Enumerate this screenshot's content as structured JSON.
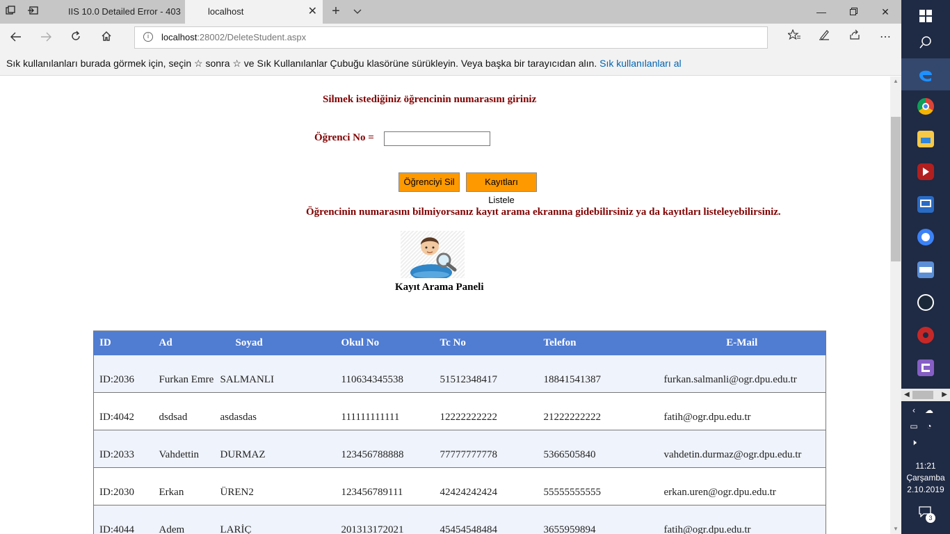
{
  "browser": {
    "tabs": [
      {
        "label": "IIS 10.0 Detailed Error - 403",
        "active": false
      },
      {
        "label": "localhost",
        "active": true
      }
    ],
    "new_tab_icon": "+",
    "tab_list_icon": "⌄",
    "address": {
      "host": "localhost",
      "path": ":28002/DeleteStudent.aspx"
    },
    "favorites_bar": {
      "text": "Sık kullanılanları burada görmek için, seçin  ☆  sonra ☆ ve Sık Kullanılanlar Çubuğu klasörüne sürükleyin. Veya başka bir tarayıcıdan alın.",
      "link": "Sık kullanılanları al"
    }
  },
  "page": {
    "heading": "Silmek istediğiniz öğrencinin numarasını giriniz",
    "student_no_label": "Öğrenci No =",
    "student_no_value": "",
    "delete_button": "Öğrenciyi Sil",
    "list_button": "Kayıtları Listele",
    "info_text": "Öğrencinin numarasını bilmiyorsanız kayıt arama ekranına gidebilirsiniz ya da kayıtları listeleyebilirsiniz.",
    "search_panel_label": "Kayıt Arama Paneli",
    "table": {
      "headers": [
        "ID",
        "Ad",
        "Soyad",
        "Okul No",
        "Tc No",
        "Telefon",
        "E-Mail"
      ],
      "rows": [
        [
          "ID:2036",
          "Furkan Emre",
          "SALMANLI",
          "110634345538",
          "51512348417",
          "18841541387",
          "furkan.salmanli@ogr.dpu.edu.tr"
        ],
        [
          "ID:4042",
          "dsdsad",
          "asdasdas",
          "111111111111",
          "12222222222",
          "21222222222",
          "fatih@ogr.dpu.edu.tr"
        ],
        [
          "ID:2033",
          "Vahdettin",
          "DURMAZ",
          "123456788888",
          "77777777778",
          "5366505840",
          "vahdetin.durmaz@ogr.dpu.edu.tr"
        ],
        [
          "ID:2030",
          "Erkan",
          "ÜREN2",
          "123456789111",
          "42424242424",
          "55555555555",
          "erkan.uren@ogr.dpu.edu.tr"
        ],
        [
          "ID:4044",
          "Adem",
          "LARİÇ",
          "201313172021",
          "45454548484",
          "3655959894",
          "fatih@ogr.dpu.edu.tr"
        ]
      ]
    }
  },
  "taskbar": {
    "time": "11:21",
    "day": "Çarşamba",
    "date": "2.10.2019",
    "notification_count": "3"
  },
  "colors": {
    "accent_text": "#800000",
    "button_bg": "#ff9900",
    "table_header": "#507cd1",
    "row_alt": "#eff3fb",
    "link": "#0063b1",
    "taskbar": "#1f2a44"
  }
}
